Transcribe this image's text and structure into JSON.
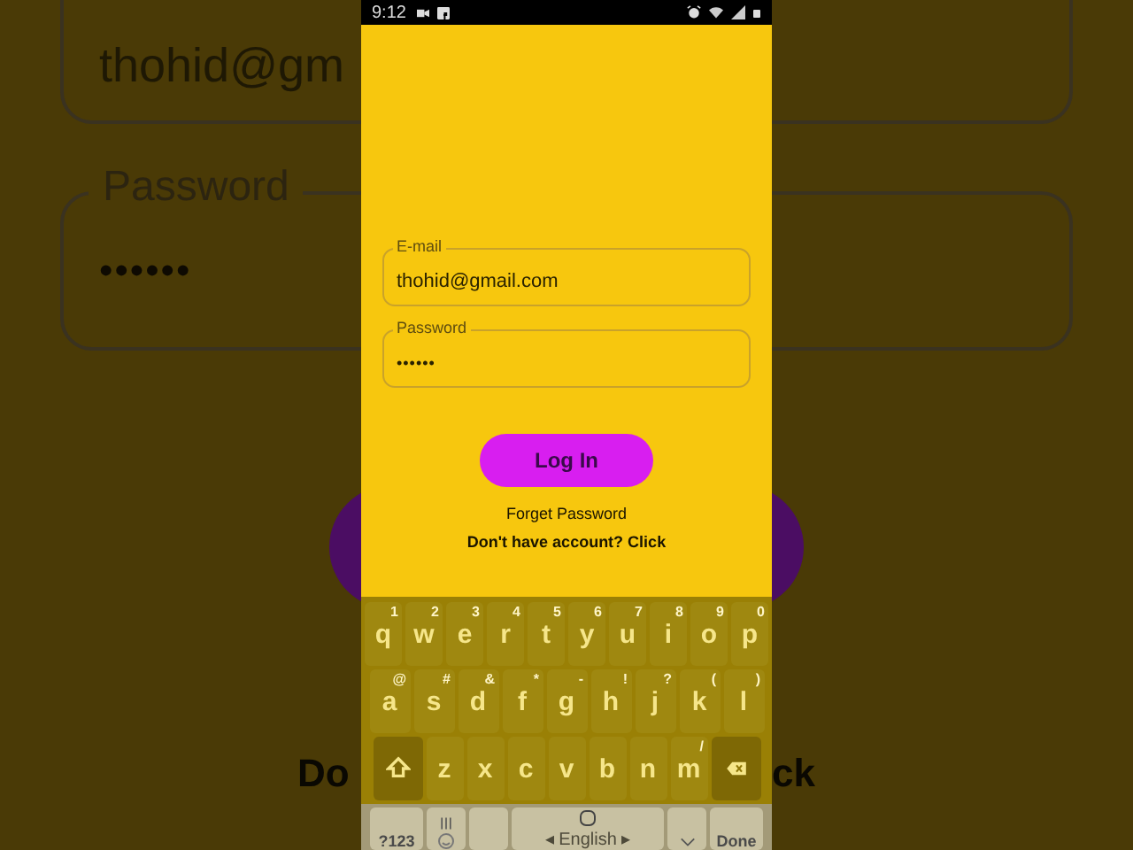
{
  "backdrop": {
    "email_value": "thohid@gm",
    "password_label": "Password",
    "password_value": "••••••",
    "left_text": "Do",
    "right_text": "ck"
  },
  "status_bar": {
    "time": "9:12"
  },
  "form": {
    "fields": [
      {
        "label": "E-mail",
        "value": "thohid@gmail.com",
        "kind": "text"
      },
      {
        "label": "Password",
        "value": "••••••",
        "kind": "password"
      }
    ],
    "login_button": "Log In",
    "forget_link": "Forget Password",
    "signup_prompt": "Don't have account? Click"
  },
  "keyboard": {
    "rows": [
      {
        "keys": [
          {
            "kind": "letter",
            "key": "q",
            "hint": "1"
          },
          {
            "kind": "letter",
            "key": "w",
            "hint": "2"
          },
          {
            "kind": "letter",
            "key": "e",
            "hint": "3"
          },
          {
            "kind": "letter",
            "key": "r",
            "hint": "4"
          },
          {
            "kind": "letter",
            "key": "t",
            "hint": "5"
          },
          {
            "kind": "letter",
            "key": "y",
            "hint": "6"
          },
          {
            "kind": "letter",
            "key": "u",
            "hint": "7"
          },
          {
            "kind": "letter",
            "key": "i",
            "hint": "8"
          },
          {
            "kind": "letter",
            "key": "o",
            "hint": "9"
          },
          {
            "kind": "letter",
            "key": "p",
            "hint": "0"
          }
        ]
      },
      {
        "keys": [
          {
            "kind": "letter",
            "key": "a",
            "hint": "@"
          },
          {
            "kind": "letter",
            "key": "s",
            "hint": "#"
          },
          {
            "kind": "letter",
            "key": "d",
            "hint": "&"
          },
          {
            "kind": "letter",
            "key": "f",
            "hint": "*"
          },
          {
            "kind": "letter",
            "key": "g",
            "hint": "-"
          },
          {
            "kind": "letter",
            "key": "h",
            "hint": "!"
          },
          {
            "kind": "letter",
            "key": "j",
            "hint": "?"
          },
          {
            "kind": "letter",
            "key": "k",
            "hint": "("
          },
          {
            "kind": "letter",
            "key": "l",
            "hint": ")"
          }
        ]
      },
      {
        "keys": [
          {
            "kind": "shift"
          },
          {
            "kind": "letter",
            "key": "z"
          },
          {
            "kind": "letter",
            "key": "x"
          },
          {
            "kind": "letter",
            "key": "c"
          },
          {
            "kind": "letter",
            "key": "v"
          },
          {
            "kind": "letter",
            "key": "b"
          },
          {
            "kind": "letter",
            "key": "n"
          },
          {
            "kind": "letter",
            "key": "m",
            "hint": "/"
          },
          {
            "kind": "backspace"
          }
        ]
      }
    ],
    "bottom": {
      "symbols": "?123",
      "space": "◂ English ▸",
      "done": "Done"
    }
  }
}
